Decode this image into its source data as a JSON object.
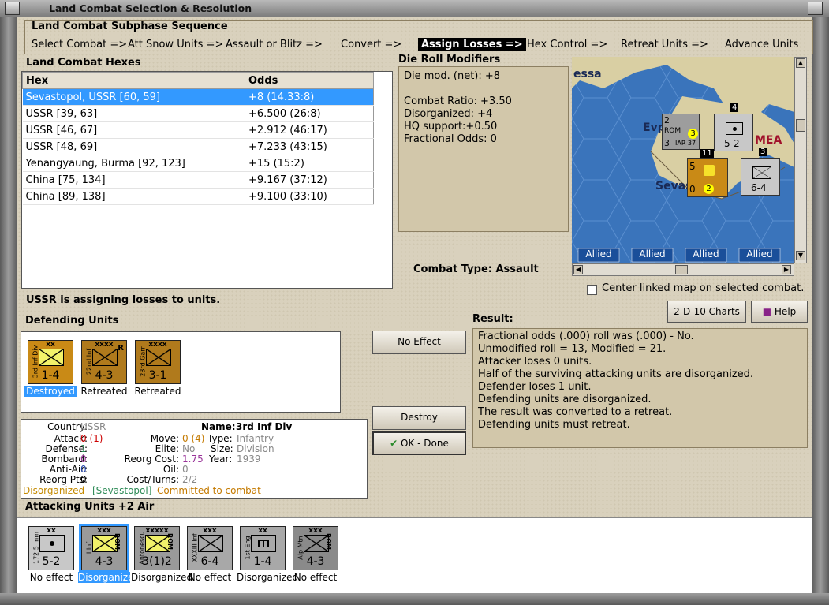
{
  "window": {
    "title": "Land Combat Selection & Resolution"
  },
  "subphase": {
    "header": "Land Combat Subphase Sequence",
    "steps": [
      "Select Combat =>",
      "Att Snow Units =>",
      "Assault or Blitz =>",
      "Convert =>",
      "Assign Losses =>",
      "Hex Control =>",
      "Retreat Units =>",
      "Advance Units"
    ]
  },
  "hexes": {
    "header": "Land Combat Hexes",
    "col_hex": "Hex",
    "col_odds": "Odds",
    "rows": [
      {
        "hex": "Sevastopol, USSR [60, 59]",
        "odds": "+8 (14.33:8)"
      },
      {
        "hex": "USSR [39, 63]",
        "odds": "+6.500 (26:8)"
      },
      {
        "hex": "USSR [46, 67]",
        "odds": "+2.912 (46:17)"
      },
      {
        "hex": "USSR [48, 69]",
        "odds": "+7.233 (43:15)"
      },
      {
        "hex": "Yenangyaung, Burma [92, 123]",
        "odds": "+15 (15:2)"
      },
      {
        "hex": "China [75, 134]",
        "odds": "+9.167 (37:12)"
      },
      {
        "hex": "China [89, 138]",
        "odds": "+9.100 (33:10)"
      }
    ]
  },
  "modifiers": {
    "header": "Die Roll Modifiers",
    "net": "Die mod. (net): +8",
    "lines": [
      "Combat Ratio: +3.50",
      "Disorganized: +4",
      "HQ support:+0.50",
      "Fractional Odds: 0"
    ]
  },
  "map": {
    "labels": {
      "essa": "essa",
      "evp": "Evp",
      "mea": "MEA",
      "sevas": "Sevas"
    },
    "allied": [
      "Allied",
      "Allied",
      "Allied",
      "Allied"
    ],
    "counters": {
      "rom_strength": "2",
      "rom_move": "3",
      "rom_marker": "3",
      "rom_tag": "ROM",
      "rom_sub": "IAR 37",
      "art_top": "4",
      "art_strength": "5-2",
      "stack_top": "11",
      "stack_nums": "5",
      "stack_bottom": "0",
      "stack_marker": "2",
      "xxx_top": "3",
      "xxx_strength": "6-4"
    }
  },
  "combat_type": {
    "label": "Combat Type:",
    "value": "Assault"
  },
  "center_map": {
    "label": "Center linked map on selected combat.",
    "checked": false
  },
  "status": "USSR is assigning losses to units.",
  "defending": {
    "header": "Defending Units",
    "units": [
      {
        "size": "xx",
        "side": "3rd Inf Div",
        "strength": "1-4",
        "caption": "Destroyed",
        "color": "#c98a16"
      },
      {
        "size": "xxxx",
        "side": "22nd Inf",
        "strength": "4-3",
        "caption": "Retreated",
        "color": "#b07a1c",
        "r": "R"
      },
      {
        "size": "xxxx",
        "side": "23rd Garr",
        "strength": "3-1",
        "caption": "Retreated",
        "color": "#b07a1c"
      }
    ]
  },
  "buttons": {
    "charts": "2-D-10 Charts",
    "help": "Help",
    "no_effect": "No Effect",
    "destroy": "Destroy",
    "ok": "OK - Done"
  },
  "result": {
    "header": "Result:",
    "lines": [
      "Fractional odds (.000) roll was (.000)  - No.",
      "Unmodified roll = 13, Modified = 21.",
      "Attacker loses 0 units.",
      "Half of the surviving attacking units are disorganized.",
      "Defender loses 1 unit.",
      "Defending units are disorganized.",
      "The result was converted to a retreat.",
      "Defending units must retreat."
    ]
  },
  "details": {
    "country_label": "Country:",
    "country": "USSR",
    "attack_label": "Attack:",
    "attack": "0",
    "attack_orig": "(1)",
    "defense_label": "Defense:",
    "defense": "1",
    "bombard_label": "Bombard:",
    "bombard": "0",
    "antiair_label": "Anti-Air:",
    "antiair": "0",
    "reorgpts_label": "Reorg Pts:",
    "reorgpts": "0",
    "name_label": "Name:",
    "name": "3rd Inf Div",
    "move_label": "Move:",
    "move": "0",
    "move_orig": "(4)",
    "type_label": "Type:",
    "type": "Infantry",
    "elite_label": "Elite:",
    "elite": "No",
    "size_label": "Size:",
    "size": "Division",
    "reorgcost_label": "Reorg Cost:",
    "reorgcost": "1.75",
    "year_label": "Year:",
    "year": "1939",
    "oil_label": "Oil:",
    "oil": "0",
    "costturns_label": "Cost/Turns:",
    "costturns": "2/2",
    "status1": "Disorganized",
    "status2": "[Sevastopol]",
    "status3": "Committed to combat"
  },
  "attacking": {
    "header": "Attacking Units +2 Air",
    "units": [
      {
        "size": "xx",
        "side": "172.5 mm",
        "strength": "5-2",
        "caption": "No effect",
        "color": "#c8c8c8",
        "kind": "art"
      },
      {
        "size": "xxx",
        "side": "I Inf",
        "strength": "4-3",
        "caption": "Disorganized",
        "color": "#9a9a9a",
        "tag": "ROM",
        "sel": true
      },
      {
        "size": "xxxxx",
        "side": "Antonescu",
        "strength": "3(1)2",
        "caption": "Disorganized",
        "color": "#9a9a9a",
        "tag": "ROM"
      },
      {
        "size": "xxx",
        "side": "XXXIII Inf",
        "strength": "6-4",
        "caption": "No effect",
        "color": "#a8a8a8"
      },
      {
        "size": "xx",
        "side": "1st Eng",
        "strength": "1-4",
        "caption": "Disorganized",
        "color": "#a8a8a8",
        "kind": "eng"
      },
      {
        "size": "xxx",
        "side": "Alp Mtn",
        "strength": "4-3",
        "caption": "No effect",
        "color": "#8a8a8a",
        "tag": "ROM"
      }
    ]
  },
  "colors": {
    "selection": "#3399ff",
    "axis_yellow": "#f2f26a",
    "ussr_brown": "#c98a16",
    "attack_red": "#cc0000",
    "purple": "#993399",
    "orange": "#c47a00",
    "green": "#2e8b57"
  }
}
